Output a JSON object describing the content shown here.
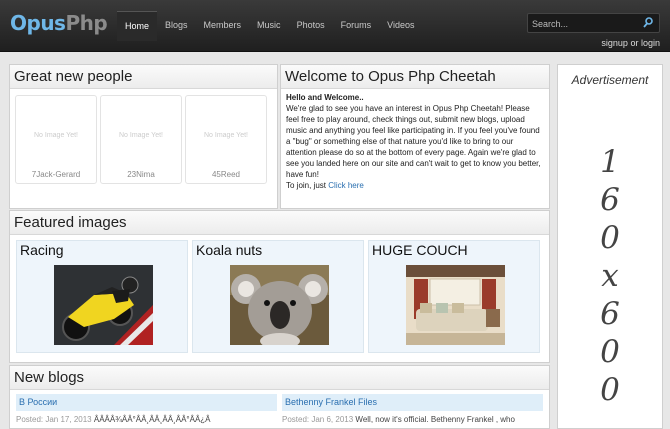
{
  "logo": {
    "part1": "Opus",
    "part2": "Php"
  },
  "nav": {
    "items": [
      {
        "label": "Home"
      },
      {
        "label": "Blogs"
      },
      {
        "label": "Members"
      },
      {
        "label": "Music"
      },
      {
        "label": "Photos"
      },
      {
        "label": "Forums"
      },
      {
        "label": "Videos"
      }
    ]
  },
  "search": {
    "placeholder": "Search..."
  },
  "auth": {
    "signup": "signup",
    "or": "or",
    "login": "login"
  },
  "people": {
    "title": "Great new people",
    "no_image_text": "No Image Yet!",
    "members": [
      {
        "name": "7Jack-Gerard"
      },
      {
        "name": "23Nima"
      },
      {
        "name": "45Reed"
      }
    ]
  },
  "welcome": {
    "title": "Welcome to Opus Php Cheetah",
    "heading": "Hello and Welcome..",
    "body": "We're glad to see you have an interest in Opus Php Cheetah! Please feel free to play around, check things out, submit new blogs, upload music and anything you feel like participating in. If you feel you've found a \"bug\" or something else of that nature you'd like to bring to our attention please do so at the bottom of every page. Again we're glad to see you landed here on our site and can't wait to get to know you better, have fun!",
    "join_text": "To join, just",
    "join_link": "Click here"
  },
  "featured": {
    "title": "Featured images",
    "images": [
      {
        "title": "Racing"
      },
      {
        "title": "Koala nuts"
      },
      {
        "title": "HUGE COUCH"
      }
    ]
  },
  "blogs": {
    "title": "New blogs",
    "posts": [
      {
        "title": "В России",
        "meta": "Posted: Jan 17, 2013",
        "excerpt": "ÂÂÂÂ¾ÂÂ°ÂÂ¸ÂÂ¸ÂÂ¸ÂÂ°ÂÂ¿Â"
      },
      {
        "title": "Bethenny Frankel Files",
        "meta": "Posted: Jan 6, 2013",
        "excerpt": "Well, now it's official.  Bethenny Frankel , who"
      }
    ]
  },
  "ad": {
    "title": "Advertisement",
    "size": [
      "1",
      "6",
      "0",
      "x",
      "6",
      "0",
      "0"
    ]
  },
  "colors": {
    "accent": "#2a6fb0",
    "header": "#2b2b2b",
    "featured_bg": "#eef5fb",
    "blog_title_bg": "#dfeef9"
  }
}
